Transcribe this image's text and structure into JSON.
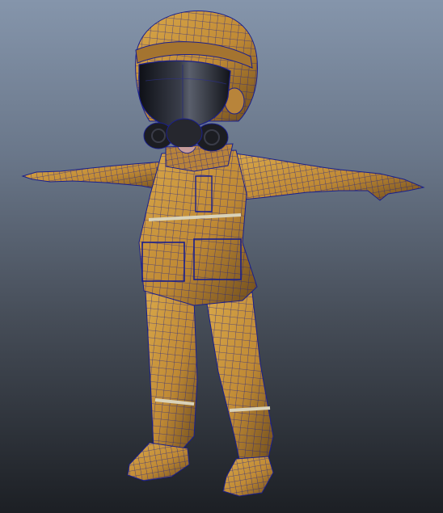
{
  "viewport": {
    "background_top": "#8595ab",
    "background_bottom": "#1c1f24"
  },
  "model": {
    "name": "character-model",
    "pose": "t-pose",
    "display_mode": "wireframe-on-shaded",
    "surface_color": "#c9973e",
    "surface_shadow": "#7a5520",
    "wire_color": "#1a1f8c",
    "visor_color": "#1b1d24",
    "stripe_color": "#d9d2b8"
  }
}
